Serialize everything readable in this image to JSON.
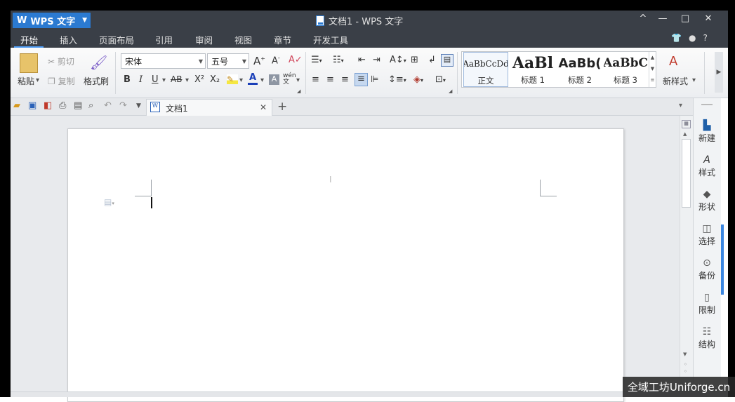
{
  "app": {
    "name": "WPS 文字",
    "window_title": "文档1 - WPS 文字",
    "window_controls": [
      "^",
      "—",
      "□",
      "✕"
    ],
    "status_icons": [
      "shirt-icon",
      "cloud-icon",
      "?"
    ]
  },
  "menu": {
    "tabs": [
      "开始",
      "插入",
      "页面布局",
      "引用",
      "审阅",
      "视图",
      "章节",
      "开发工具"
    ],
    "active": "开始"
  },
  "clipboard": {
    "paste": "粘贴",
    "cut": "剪切",
    "copy": "复制",
    "format_painter": "格式刷"
  },
  "font": {
    "name": "宋体",
    "size": "五号",
    "bold": "B",
    "italic": "I",
    "underline": "U",
    "strike": "AB",
    "superscript": "X²",
    "subscript": "X₂",
    "font_color": "A",
    "phonetic": "wén"
  },
  "styles": [
    {
      "preview": "AaBbCcDd",
      "name": "正文"
    },
    {
      "preview": "AaBl",
      "name": "标题 1"
    },
    {
      "preview": "AaBb(",
      "name": "标题 2"
    },
    {
      "preview": "AaBbC",
      "name": "标题 3"
    }
  ],
  "new_style": "新样式",
  "doc_tab": {
    "title": "文档1",
    "close": "✕",
    "add": "+"
  },
  "right_panel": [
    {
      "label": "新建",
      "icon": "new-doc-icon"
    },
    {
      "label": "样式",
      "icon": "style-icon"
    },
    {
      "label": "形状",
      "icon": "shape-icon"
    },
    {
      "label": "选择",
      "icon": "select-icon"
    },
    {
      "label": "备份",
      "icon": "backup-icon"
    },
    {
      "label": "限制",
      "icon": "restrict-icon"
    },
    {
      "label": "结构",
      "icon": "structure-icon"
    }
  ],
  "watermark": "全域工坊Uniforge.cn",
  "colors": {
    "accent": "#2b7ad1",
    "titlebar": "#3a3f47",
    "active_tab_line": "#4d9cf5"
  }
}
